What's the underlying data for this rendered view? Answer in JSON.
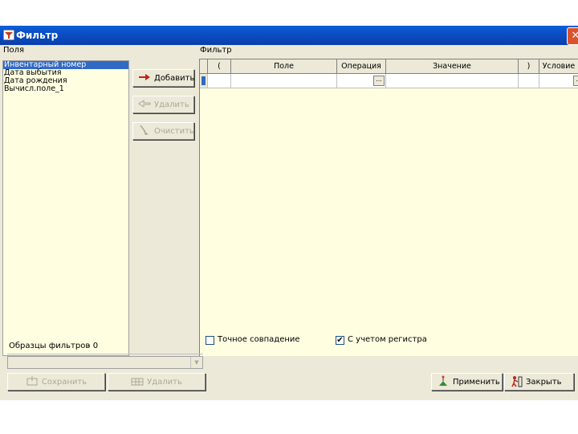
{
  "window": {
    "title": "Фильтр",
    "close_label": "✕"
  },
  "fields_panel": {
    "label": "Поля",
    "items": [
      "Инвентарный номер",
      "Дата выбытия",
      "Дата рождения",
      "Вычисл.поле_1"
    ],
    "selected_index": 0
  },
  "actions": {
    "add": "Добавить",
    "delete": "Удалить",
    "clear": "Очистить"
  },
  "filter_panel": {
    "label": "Фильтр",
    "columns": [
      "(",
      "Поле",
      "Операция",
      "Значение",
      ")",
      "Условие"
    ],
    "ellipsis": "..."
  },
  "options": {
    "exact_match": {
      "label": "Точное совпадение",
      "checked": false
    },
    "case_sensitive": {
      "label": "С учетом регистра",
      "checked": true
    }
  },
  "samples": {
    "label": "Образцы фильтров",
    "count": "- 0",
    "save": "Сохранить",
    "delete": "Удалить"
  },
  "footer": {
    "apply": "Применить",
    "close": "Закрыть"
  }
}
